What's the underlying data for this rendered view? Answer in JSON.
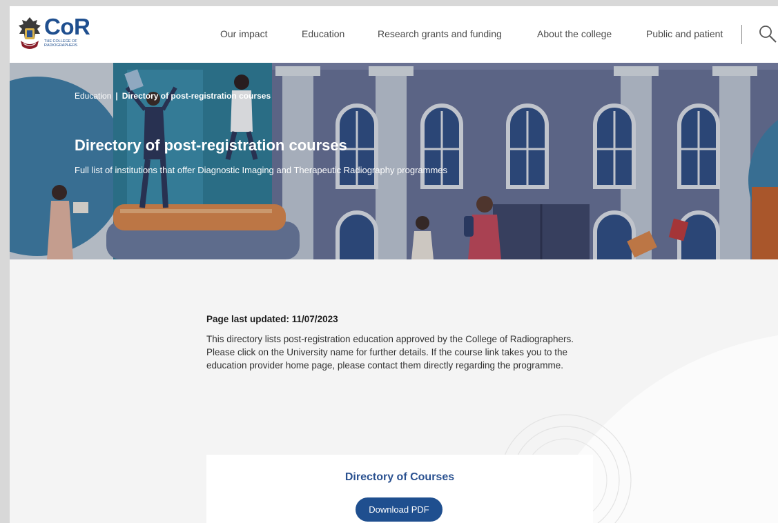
{
  "header": {
    "logo_text": "CoR",
    "logo_subtitle": "THE COLLEGE OF RADIOGRAPHERS",
    "nav": [
      {
        "label": "Our impact"
      },
      {
        "label": "Education"
      },
      {
        "label": "Research grants and funding"
      },
      {
        "label": "About the college"
      },
      {
        "label": "Public and patient"
      }
    ],
    "search_icon": "search-icon"
  },
  "hero": {
    "breadcrumb": {
      "parent": "Education",
      "separator": "|",
      "current": "Directory of post-registration courses"
    },
    "title": "Directory of post-registration courses",
    "subtitle": "Full list of institutions that offer Diagnostic Imaging and Therapeutic Radiography programmes"
  },
  "main": {
    "updated": "Page last updated: 11/07/2023",
    "description": "This directory lists post-registration education approved by the College of Radiographers. Please click on the University name for further details. If the course link takes you to the education provider home page, please contact them directly regarding the programme."
  },
  "card": {
    "title": "Directory of Courses",
    "button_label": "Download PDF"
  },
  "colors": {
    "brand_blue": "#1f4f8f",
    "hero_building": "#6a7398",
    "page_bg": "#f4f4f4"
  }
}
